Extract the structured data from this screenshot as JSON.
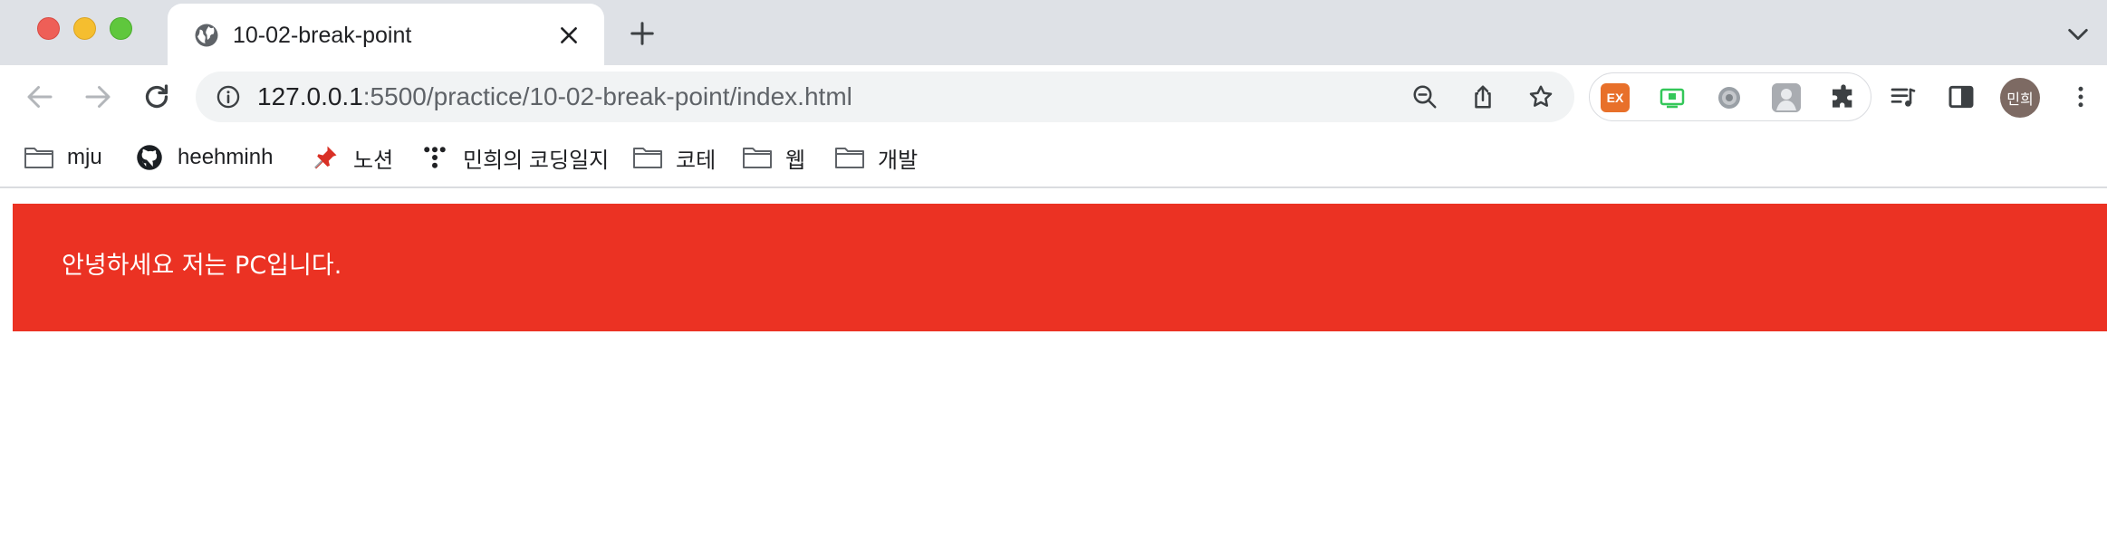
{
  "tab": {
    "title": "10-02-break-point"
  },
  "omnibox": {
    "url_host": "127.0.0.1",
    "url_path": ":5500/practice/10-02-break-point/index.html"
  },
  "extensions": {
    "ex_label": "EX"
  },
  "profile": {
    "avatar_label": "민희",
    "color": "#7d6a63"
  },
  "bookmarks": [
    {
      "label": "mju",
      "icon": "folder-icon"
    },
    {
      "label": "heehminh",
      "icon": "github-icon"
    },
    {
      "label": "노션",
      "icon": "pushpin-icon"
    },
    {
      "label": "민희의 코딩일지",
      "icon": "tistory-icon"
    },
    {
      "label": "코테",
      "icon": "folder-icon"
    },
    {
      "label": "웹",
      "icon": "folder-icon"
    },
    {
      "label": "개발",
      "icon": "folder-icon"
    }
  ],
  "page": {
    "banner_text": "안녕하세요 저는 PC입니다.",
    "banner_color": "#eb3223"
  }
}
